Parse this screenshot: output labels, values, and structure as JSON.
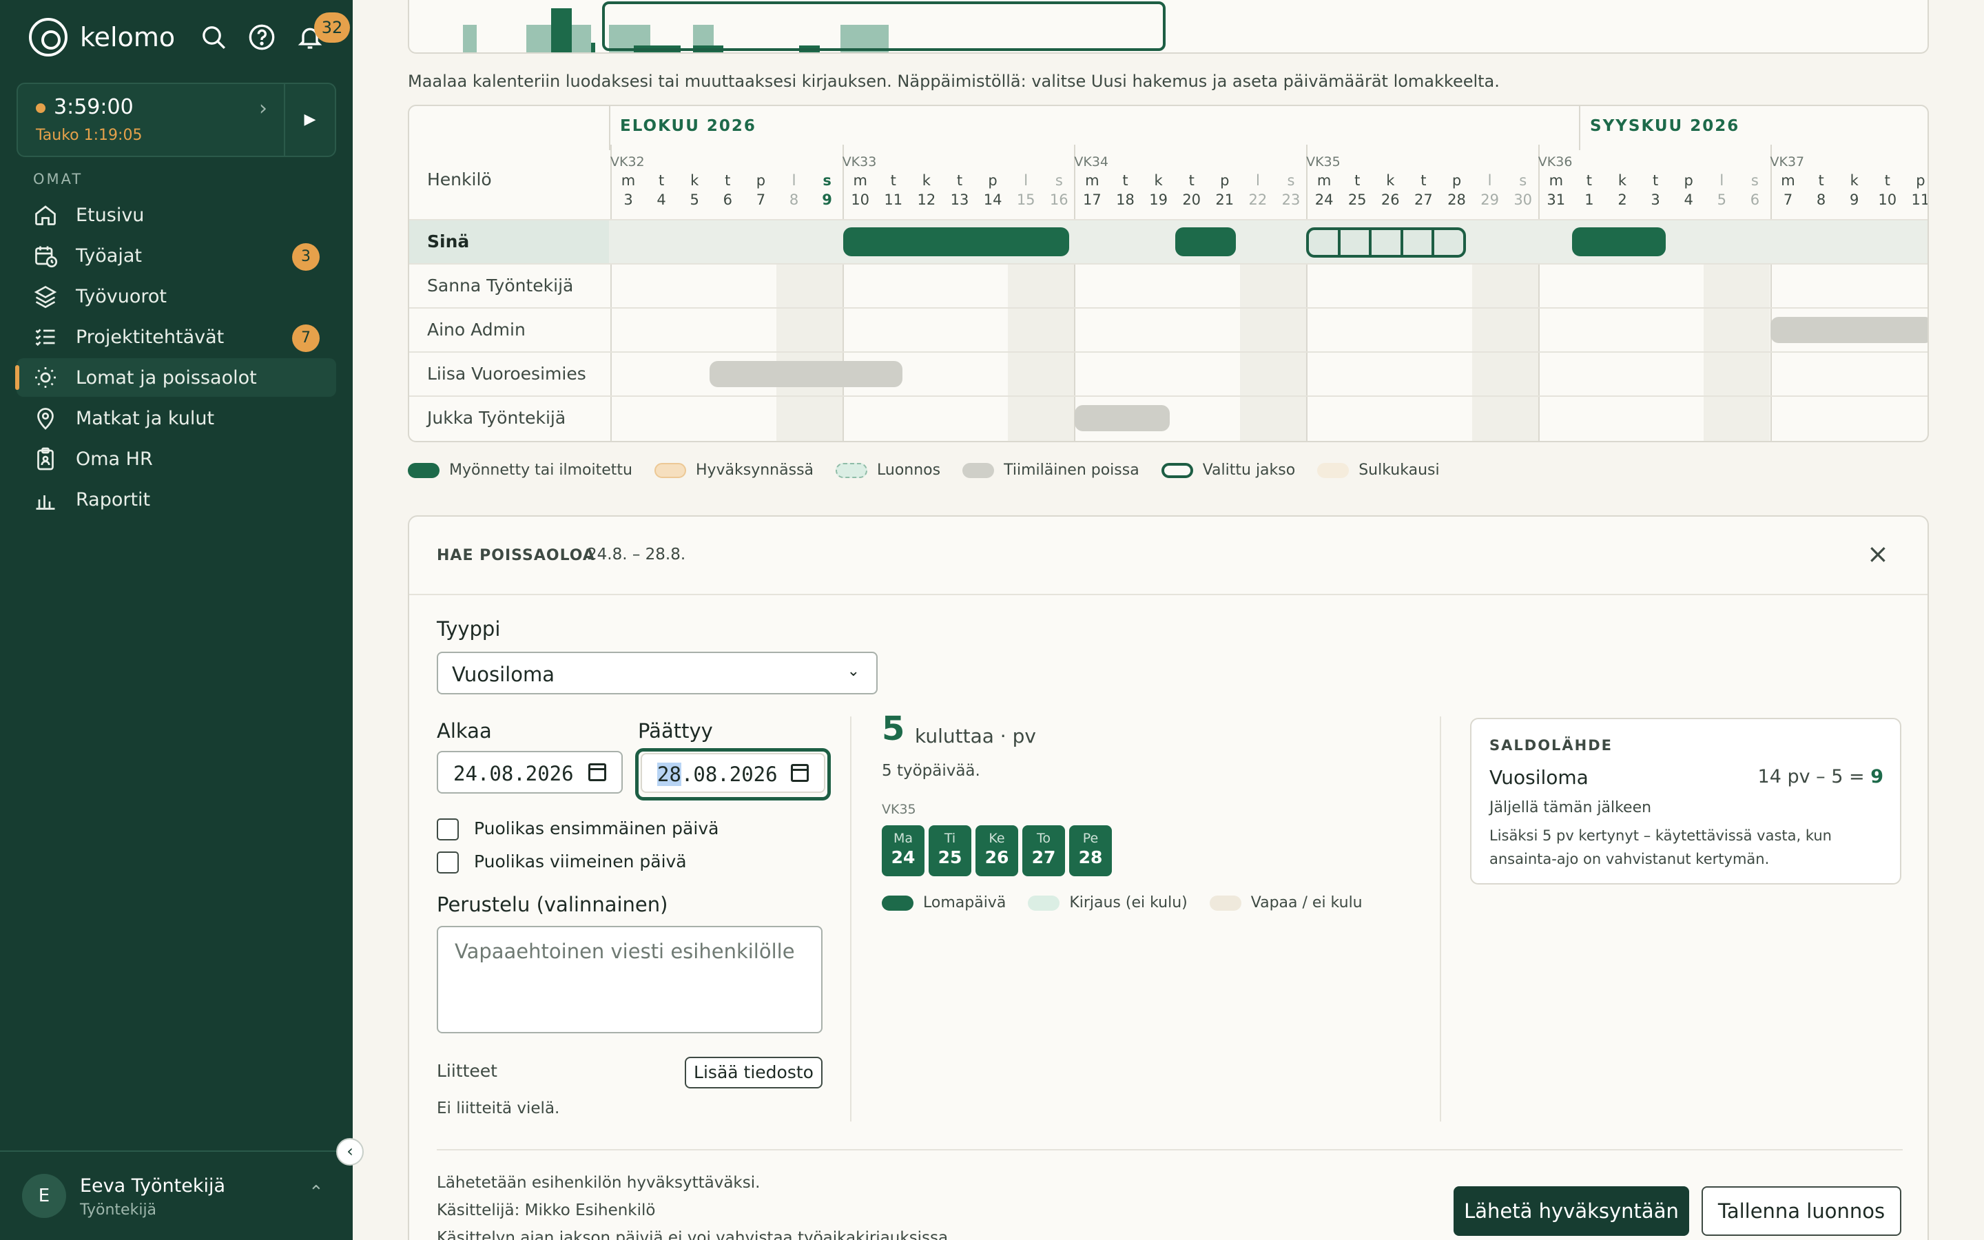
{
  "app": {
    "brand": "kelomo",
    "notifications": "32"
  },
  "timer": {
    "time": "3:59:00",
    "pause": "Tauko 1:19:05"
  },
  "sidebar": {
    "section": "OMAT",
    "items": [
      {
        "label": "Etusivu",
        "icon": "home-icon"
      },
      {
        "label": "Työajat",
        "icon": "calendar-clock-icon",
        "badge": "3"
      },
      {
        "label": "Työvuorot",
        "icon": "layers-icon"
      },
      {
        "label": "Projektitehtävät",
        "icon": "checklist-icon",
        "badge": "7"
      },
      {
        "label": "Lomat ja poissaolot",
        "icon": "sun-icon",
        "active": true
      },
      {
        "label": "Matkat ja kulut",
        "icon": "location-pin-icon"
      },
      {
        "label": "Oma HR",
        "icon": "clipboard-icon"
      },
      {
        "label": "Raportit",
        "icon": "bar-chart-icon"
      }
    ]
  },
  "user": {
    "initial": "E",
    "name": "Eeva Työntekijä",
    "role": "Työntekijä"
  },
  "hint": "Maalaa kalenteriin luodaksesi tai muuttaaksesi kirjauksen. Näppäimistöllä: valitse Uusi hakemus ja aseta päivämäärät lomakkeelta.",
  "calendar": {
    "person_header": "Henkilö",
    "months": [
      "ELOKUU 2026",
      "SYYSKUU 2026"
    ],
    "weeks": [
      "VK32",
      "VK33",
      "VK34",
      "VK35",
      "VK36",
      "VK37"
    ],
    "day_names": [
      "m",
      "t",
      "k",
      "t",
      "p",
      "l",
      "s",
      "m",
      "t",
      "k",
      "t",
      "p",
      "l",
      "s",
      "m",
      "t",
      "k",
      "t",
      "p",
      "l",
      "s",
      "m",
      "t",
      "k",
      "t",
      "p",
      "l",
      "s",
      "m",
      "t",
      "k",
      "t",
      "p",
      "l",
      "s",
      "m",
      "t",
      "k",
      "t",
      "p"
    ],
    "day_numbers": [
      "3",
      "4",
      "5",
      "6",
      "7",
      "8",
      "9",
      "10",
      "11",
      "12",
      "13",
      "14",
      "15",
      "16",
      "17",
      "18",
      "19",
      "20",
      "21",
      "22",
      "23",
      "24",
      "25",
      "26",
      "27",
      "28",
      "29",
      "30",
      "31",
      "1",
      "2",
      "3",
      "4",
      "5",
      "6",
      "7",
      "8",
      "9",
      "10",
      "11"
    ],
    "people": [
      "Sinä",
      "Sanna Työntekijä",
      "Aino Admin",
      "Liisa Vuoroesimies",
      "Jukka Työntekijä"
    ]
  },
  "legend": [
    {
      "label": "Myönnetty tai ilmoitettu",
      "color": "#1d6a4a"
    },
    {
      "label": "Hyväksynnässä",
      "color": "#f6dfbe"
    },
    {
      "label": "Luonnos",
      "color": "#dbeee4"
    },
    {
      "label": "Tiimiläinen poissa",
      "color": "#cfcfc8"
    },
    {
      "label": "Valittu jakso",
      "color": "#1d5e44"
    },
    {
      "label": "Sulkukausi",
      "color": "#f5ecdc"
    }
  ],
  "form": {
    "title": "HAE POISSAOLOA",
    "range": "24.8. – 28.8.",
    "type_label": "Tyyppi",
    "type_value": "Vuosiloma",
    "start_label": "Alkaa",
    "start_value": "24.08.2026",
    "end_label": "Päättyy",
    "end_value_day": "28",
    "end_value_rest": ".08.2026",
    "half_first": "Puolikas ensimmäinen päivä",
    "half_last": "Puolikas viimeinen päivä",
    "reason_label": "Perustelu (valinnainen)",
    "reason_placeholder": "Vapaaehtoinen viesti esihenkilölle",
    "attachments_label": "Liitteet",
    "add_file": "Lisää tiedosto",
    "no_attachments": "Ei liitteitä vielä."
  },
  "summary": {
    "count": "5",
    "count_label": "kuluttaa · pv",
    "workdays": "5 työpäivää.",
    "week": "VK35",
    "days": [
      {
        "name": "Ma",
        "num": "24"
      },
      {
        "name": "Ti",
        "num": "25"
      },
      {
        "name": "Ke",
        "num": "26"
      },
      {
        "name": "To",
        "num": "27"
      },
      {
        "name": "Pe",
        "num": "28"
      }
    ],
    "legend": [
      {
        "label": "Lomapäivä",
        "color": "#1d6a4a"
      },
      {
        "label": "Kirjaus (ei kulu)",
        "color": "#dbeee4"
      },
      {
        "label": "Vapaa / ei kulu",
        "color": "#efe9dc"
      }
    ]
  },
  "saldo": {
    "title": "SALDOLÄHDE",
    "name": "Vuosiloma",
    "calc": "14 pv – 5 = ",
    "result": "9",
    "sub": "Jäljellä tämän jälkeen",
    "note": "Lisäksi 5 pv kertynyt – käytettävissä vasta, kun ansainta-ajo on vahvistanut kertymän."
  },
  "footer": {
    "line1": "Lähetetään esihenkilön hyväksyttäväksi.",
    "line2": "Käsittelijä: Mikko Esihenkilö",
    "line3": "Käsittelyn ajan jakson päiviä ei voi vahvistaa työaikakirjauksissa.",
    "submit": "Lähetä hyväksyntään",
    "draft": "Tallenna luonnos"
  }
}
